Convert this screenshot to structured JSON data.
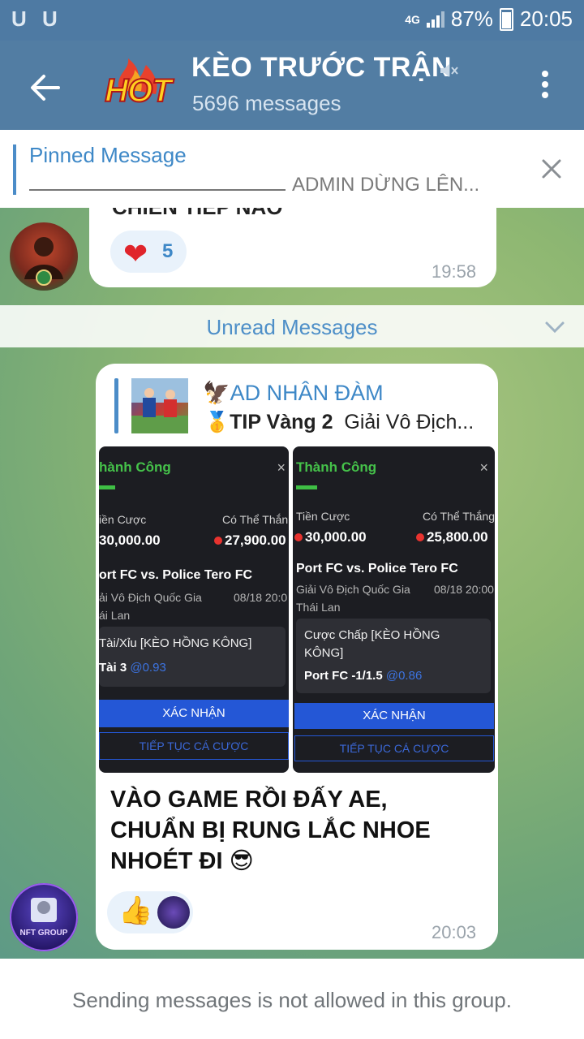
{
  "status_bar": {
    "left_icons": "U U",
    "network": "4G",
    "battery": "87%",
    "time": "20:05"
  },
  "header": {
    "back_icon": "back-arrow-icon",
    "logo_text": "HOT",
    "title": "KÈO TRƯỚC TRẬN",
    "subtitle": "5696 messages",
    "mute_icon": "muted-speaker-icon",
    "menu_icon": "more-vertical-icon"
  },
  "pinned": {
    "label": "Pinned Message",
    "text": "ADMIN DỪNG LÊN..."
  },
  "message1": {
    "cut_text": "CHIẾN TIẾP NÀO",
    "reaction_emoji": "❤",
    "reaction_count": "5",
    "time": "19:58"
  },
  "unread": {
    "label": "Unread Messages"
  },
  "message2": {
    "reply_name": "🦅AD NHÂN ĐÀM",
    "reply_medal": "🥇",
    "reply_bold": "TIP Vàng 2",
    "reply_rest": "Giải Vô Địch...",
    "shot1": {
      "status": "hành Công",
      "stake_label": "iền Cược",
      "win_label": "Có Thể Thắn",
      "stake": "30,000.00",
      "win": "27,900.00",
      "match": "ort FC vs. Police Tero FC",
      "league": "ải Vô Địch Quốc Gia",
      "date": "08/18 20:0",
      "country": "ái Lan",
      "bet_type": "Tài/Xỉu [KÈO HỒNG KÔNG]",
      "pick": "Tài 3",
      "odds": "@0.93",
      "confirm": "XÁC NHẬN",
      "continue": "TIẾP TỤC CÁ CƯỢC"
    },
    "shot2": {
      "status": "Thành Công",
      "stake_label": "Tiền Cược",
      "win_label": "Có Thể Thắng",
      "stake": "30,000.00",
      "win": "25,800.00",
      "match": "Port FC vs. Police Tero FC",
      "league": "Giải Vô Địch Quốc Gia",
      "date": "08/18 20:00",
      "country": "Thái Lan",
      "bet_type": "Cược Chấp [KÈO HỒNG KÔNG]",
      "pick": "Port FC -1/1.5",
      "odds": "@0.86",
      "confirm": "XÁC NHẬN",
      "continue": "TIẾP TỤC CÁ CƯỢC"
    },
    "text_line1": "VÀO GAME RỒI ĐẤY AE,",
    "text_line2": "CHUẨN BỊ RUNG LẮC NHOE",
    "text_line3": "NHOÉT ĐI 😎",
    "reaction_emoji": "👍",
    "time": "20:03",
    "avatar_label": "NFT GROUP"
  },
  "footer": {
    "text": "Sending messages is not allowed in this group."
  }
}
